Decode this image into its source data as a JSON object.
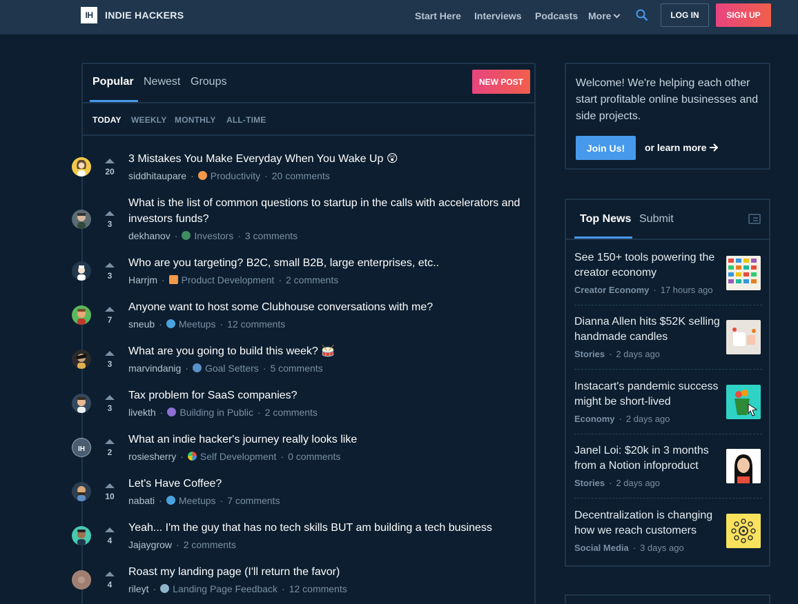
{
  "nav": {
    "brand_mark": "IH",
    "brand_name": "INDIE HACKERS",
    "links": [
      "Start Here",
      "Interviews",
      "Podcasts",
      "More"
    ],
    "login": "LOG IN",
    "signup": "SIGN UP"
  },
  "feed": {
    "tabs": [
      "Popular",
      "Newest",
      "Groups"
    ],
    "new_post": "NEW POST",
    "periods": [
      "TODAY",
      "WEEKLY",
      "MONTHLY",
      "ALL-TIME"
    ],
    "posts": [
      {
        "title": "3 Mistakes You Make Everyday When You Wake Up 😲",
        "votes": "20",
        "user": "siddhitaupare",
        "group": "Productivity",
        "comments": "20 comments"
      },
      {
        "title": "What is the list of common questions to startup in the calls with accelerators and investors funds?",
        "votes": "3",
        "user": "dekhanov",
        "group": "Investors",
        "comments": "3 comments"
      },
      {
        "title": "Who are you targeting? B2C, small B2B, large enterprises, etc..",
        "votes": "3",
        "user": "Harrjm",
        "group": "Product Development",
        "comments": "2 comments"
      },
      {
        "title": "Anyone want to host some Clubhouse conversations with me?",
        "votes": "7",
        "user": "sneub",
        "group": "Meetups",
        "comments": "12 comments"
      },
      {
        "title": "What are you going to build this week? 🥁",
        "votes": "3",
        "user": "marvindanig",
        "group": "Goal Setters",
        "comments": "5 comments"
      },
      {
        "title": "Tax problem for SaaS companies?",
        "votes": "3",
        "user": "livekth",
        "group": "Building in Public",
        "comments": "2 comments"
      },
      {
        "title": "What an indie hacker's journey really looks like",
        "votes": "2",
        "user": "rosiesherry",
        "group": "Self Development",
        "comments": "0 comments"
      },
      {
        "title": "Let's Have Coffee?",
        "votes": "10",
        "user": "nabati",
        "group": "Meetups",
        "comments": "7 comments"
      },
      {
        "title": "Yeah... I'm the guy that has no tech skills BUT am building a tech business",
        "votes": "4",
        "user": "Jajaygrow",
        "group": "",
        "comments": "2 comments"
      },
      {
        "title": "Roast my landing page (I'll return the favor)",
        "votes": "4",
        "user": "rileyt",
        "group": "Landing Page Feedback",
        "comments": "12 comments"
      }
    ]
  },
  "welcome": {
    "text": "Welcome! We're helping each other start profitable online businesses and side projects.",
    "join": "Join Us!",
    "learn_more": "or learn more"
  },
  "news": {
    "tabs": [
      "Top News",
      "Submit"
    ],
    "items": [
      {
        "title": "See 150+ tools powering the creator economy",
        "category": "Creator Economy",
        "time": "17 hours ago"
      },
      {
        "title": "Dianna Allen hits $52K selling handmade candles",
        "category": "Stories",
        "time": "2 days ago"
      },
      {
        "title": "Instacart's pandemic success might be short-lived",
        "category": "Economy",
        "time": "2 days ago"
      },
      {
        "title": "Janel Loi: $20k in 3 months from a Notion infoproduct",
        "category": "Stories",
        "time": "2 days ago"
      },
      {
        "title": "Decentralization is changing how we reach customers",
        "category": "Social Media",
        "time": "3 days ago"
      }
    ]
  },
  "colors": {
    "background": "#0c1e2f",
    "nav": "#1f364d",
    "accent": "#4799eb",
    "cta_gradient_start": "#e8447f",
    "cta_gradient_end": "#f05f4c"
  }
}
